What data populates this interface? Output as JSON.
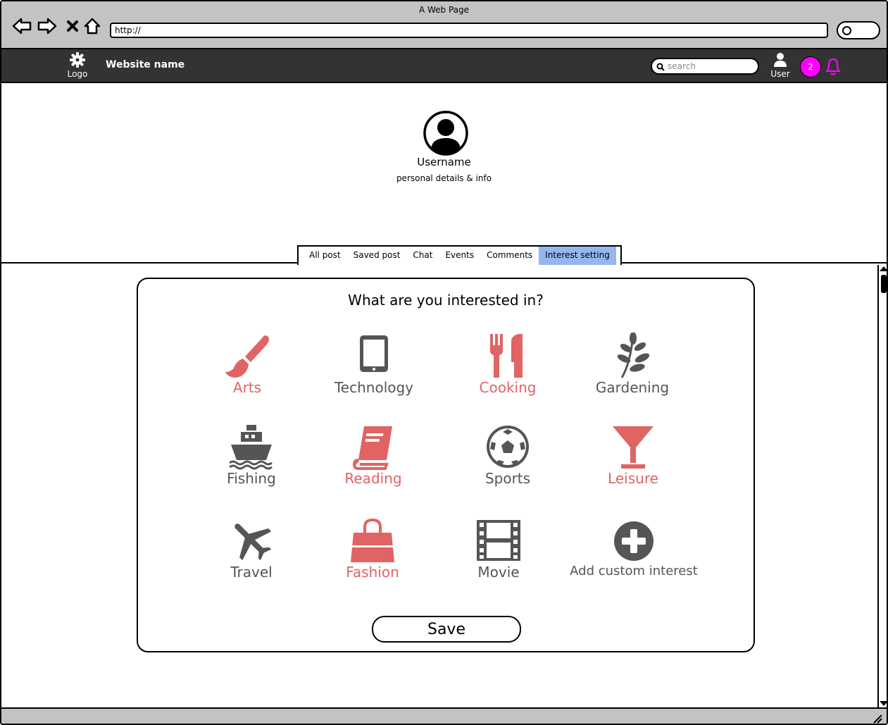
{
  "browser": {
    "title": "A Web Page",
    "url": "http://"
  },
  "header": {
    "logo_label": "Logo",
    "site_name": "Website name",
    "search_placeholder": "search",
    "user_label": "User",
    "notification_count": "2"
  },
  "profile": {
    "username": "Username",
    "details": "personal details & info"
  },
  "tabs": [
    {
      "label": "All post",
      "active": false
    },
    {
      "label": "Saved post",
      "active": false
    },
    {
      "label": "Chat",
      "active": false
    },
    {
      "label": "Events",
      "active": false
    },
    {
      "label": "Comments",
      "active": false
    },
    {
      "label": "Interest setting",
      "active": true
    }
  ],
  "interests": {
    "title": "What are you interested in?",
    "items": [
      {
        "label": "Arts",
        "icon": "paintbrush-icon",
        "selected": true
      },
      {
        "label": "Technology",
        "icon": "tablet-icon",
        "selected": false
      },
      {
        "label": "Cooking",
        "icon": "cutlery-icon",
        "selected": true
      },
      {
        "label": "Gardening",
        "icon": "leaf-icon",
        "selected": false
      },
      {
        "label": "Fishing",
        "icon": "ship-icon",
        "selected": false
      },
      {
        "label": "Reading",
        "icon": "book-icon",
        "selected": true
      },
      {
        "label": "Sports",
        "icon": "soccer-ball-icon",
        "selected": false
      },
      {
        "label": "Leisure",
        "icon": "cocktail-glass-icon",
        "selected": true
      },
      {
        "label": "Travel",
        "icon": "airplane-icon",
        "selected": false
      },
      {
        "label": "Fashion",
        "icon": "shopping-bag-icon",
        "selected": true
      },
      {
        "label": "Movie",
        "icon": "film-icon",
        "selected": false
      },
      {
        "label": "Add custom interest",
        "icon": "plus-circle-icon",
        "selected": false
      }
    ],
    "save_label": "Save"
  },
  "colors": {
    "selected": "#e06464",
    "unselected": "#555555",
    "active_tab": "#96b6ef",
    "header_bg": "#333333",
    "badge": "#ff00ff"
  }
}
